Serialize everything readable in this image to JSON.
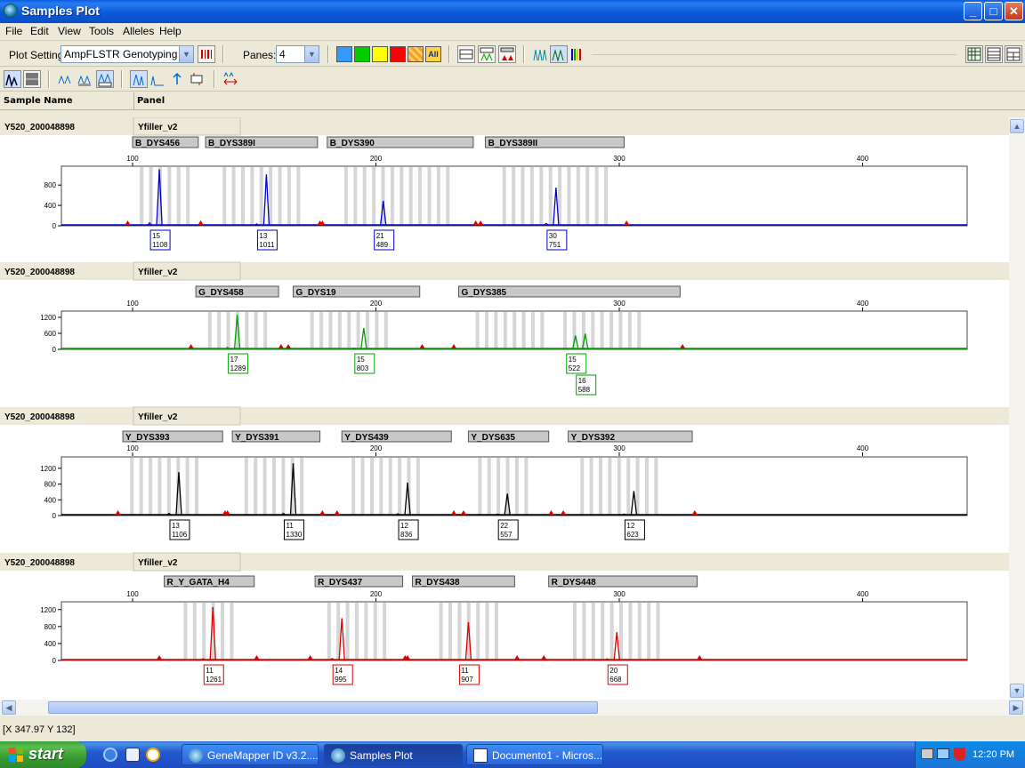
{
  "window": {
    "title": "Samples Plot"
  },
  "menu": [
    "File",
    "Edit",
    "View",
    "Tools",
    "Alleles",
    "Help"
  ],
  "toolbar": {
    "plot_setting_label": "Plot Setting:",
    "plot_setting_value": "AmpFLSTR Genotyping",
    "panes_label": "Panes:",
    "panes_value": "4",
    "all_label": "All"
  },
  "table_header": {
    "sample_name": "Sample Name",
    "panel": "Panel"
  },
  "colors": {
    "blue": "#0000c8",
    "green": "#00a000",
    "black": "#000000",
    "red": "#dd0000"
  },
  "panes": [
    {
      "sample": "Y520_200048898",
      "panel": "Yfiller_v2",
      "dye": "blue",
      "axis_ticks": [
        100,
        200,
        300,
        400
      ],
      "y_ticks": [
        0,
        400,
        800
      ],
      "ymax": 1100,
      "markers": [
        {
          "name": "B_DYS456",
          "start": 100,
          "end": 127
        },
        {
          "name": "B_DYS389I",
          "start": 130,
          "end": 176
        },
        {
          "name": "B_DYS390",
          "start": 180,
          "end": 240
        },
        {
          "name": "B_DYS389II",
          "start": 245,
          "end": 302
        }
      ],
      "bins": [
        [
          103,
          125
        ],
        [
          137,
          168
        ],
        [
          187,
          230
        ],
        [
          252,
          297
        ]
      ],
      "peaks": [
        {
          "x": 111,
          "h": 1108,
          "allele": "15",
          "value": "1108"
        },
        {
          "x": 155,
          "h": 1011,
          "allele": "13",
          "value": "1011"
        },
        {
          "x": 203,
          "h": 489,
          "allele": "21",
          "value": "489"
        },
        {
          "x": 274,
          "h": 751,
          "allele": "30",
          "value": "751"
        }
      ],
      "minor": [
        {
          "x": 107,
          "h": 60
        },
        {
          "x": 151,
          "h": 40
        },
        {
          "x": 270,
          "h": 50
        }
      ]
    },
    {
      "sample": "Y520_200048898",
      "panel": "Yfiller_v2",
      "dye": "green",
      "axis_ticks": [
        100,
        200,
        300,
        400
      ],
      "y_ticks": [
        0,
        600,
        1200
      ],
      "ymax": 1300,
      "markers": [
        {
          "name": "G_DYS458",
          "start": 126,
          "end": 160
        },
        {
          "name": "G_DYS19",
          "start": 166,
          "end": 218
        },
        {
          "name": "G_DYS385",
          "start": 234,
          "end": 325
        }
      ],
      "bins": [
        [
          131,
          157
        ],
        [
          173,
          205
        ],
        [
          241,
          270
        ],
        [
          277,
          308
        ]
      ],
      "peaks": [
        {
          "x": 143,
          "h": 1289,
          "allele": "17",
          "value": "1289"
        },
        {
          "x": 195,
          "h": 803,
          "allele": "15",
          "value": "803"
        },
        {
          "x": 282,
          "h": 522,
          "allele": "15",
          "value": "522"
        },
        {
          "x": 286,
          "h": 588,
          "allele": "16",
          "value": "588"
        }
      ],
      "minor": [
        {
          "x": 139,
          "h": 80
        },
        {
          "x": 191,
          "h": 50
        }
      ]
    },
    {
      "sample": "Y520_200048898",
      "panel": "Yfiller_v2",
      "dye": "black",
      "axis_ticks": [
        100,
        200,
        300,
        400
      ],
      "y_ticks": [
        0,
        400,
        800,
        1200
      ],
      "ymax": 1400,
      "markers": [
        {
          "name": "Y_DYS393",
          "start": 96,
          "end": 137
        },
        {
          "name": "Y_DYS391",
          "start": 141,
          "end": 177
        },
        {
          "name": "Y_DYS439",
          "start": 186,
          "end": 231
        },
        {
          "name": "Y_DYS635",
          "start": 238,
          "end": 271
        },
        {
          "name": "Y_DYS392",
          "start": 279,
          "end": 330
        }
      ],
      "bins": [
        [
          99,
          128
        ],
        [
          146,
          170
        ],
        [
          190,
          220
        ],
        [
          242,
          262
        ],
        [
          284,
          315
        ]
      ],
      "peaks": [
        {
          "x": 119,
          "h": 1106,
          "allele": "13",
          "value": "1106"
        },
        {
          "x": 166,
          "h": 1330,
          "allele": "11",
          "value": "1330"
        },
        {
          "x": 213,
          "h": 836,
          "allele": "12",
          "value": "836"
        },
        {
          "x": 254,
          "h": 557,
          "allele": "22",
          "value": "557"
        },
        {
          "x": 306,
          "h": 623,
          "allele": "12",
          "value": "623"
        }
      ],
      "minor": [
        {
          "x": 115,
          "h": 60
        },
        {
          "x": 162,
          "h": 60
        },
        {
          "x": 209,
          "h": 50
        },
        {
          "x": 250,
          "h": 40
        },
        {
          "x": 302,
          "h": 40
        }
      ]
    },
    {
      "sample": "Y520_200048898",
      "panel": "Yfiller_v2",
      "dye": "red",
      "axis_ticks": [
        100,
        200,
        300,
        400
      ],
      "y_ticks": [
        0,
        400,
        800,
        1200
      ],
      "ymax": 1300,
      "markers": [
        {
          "name": "R_Y_GATA_H4",
          "start": 113,
          "end": 150
        },
        {
          "name": "R_DYS437",
          "start": 175,
          "end": 211
        },
        {
          "name": "R_DYS438",
          "start": 215,
          "end": 257
        },
        {
          "name": "R_DYS448",
          "start": 271,
          "end": 332
        }
      ],
      "bins": [
        [
          121,
          143
        ],
        [
          180,
          203
        ],
        [
          226,
          250
        ],
        [
          281,
          316
        ]
      ],
      "peaks": [
        {
          "x": 133,
          "h": 1261,
          "allele": "11",
          "value": "1261"
        },
        {
          "x": 186,
          "h": 995,
          "allele": "14",
          "value": "995"
        },
        {
          "x": 238,
          "h": 907,
          "allele": "11",
          "value": "907"
        },
        {
          "x": 299,
          "h": 668,
          "allele": "20",
          "value": "668"
        }
      ],
      "minor": [
        {
          "x": 129,
          "h": 40
        },
        {
          "x": 182,
          "h": 50
        },
        {
          "x": 295,
          "h": 40
        }
      ]
    }
  ],
  "status": "[X 347.97  Y 132]",
  "taskbar": {
    "start": "start",
    "tasks": [
      "GeneMapper ID v3.2....",
      "Samples Plot",
      "Documento1 - Micros..."
    ],
    "clock": "12:20 PM"
  }
}
